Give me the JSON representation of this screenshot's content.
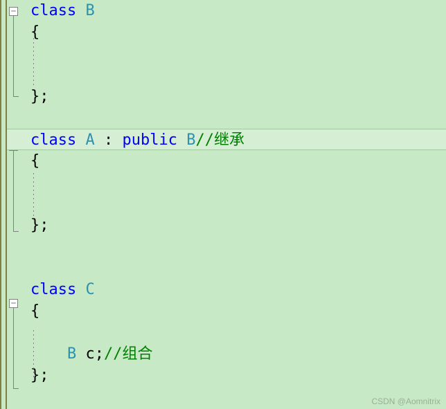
{
  "classes": {
    "b": {
      "keyword": "class",
      "name": "B",
      "open": "{",
      "close": "};"
    },
    "a": {
      "keyword": "class",
      "name": "A",
      "colon": " : ",
      "access": "public",
      "base": "B",
      "comment": "//继承",
      "open": "{",
      "close": "};"
    },
    "c": {
      "keyword": "class",
      "name": "C",
      "open": "{",
      "member_type": "B",
      "member_name": " c;",
      "comment": "//组合",
      "close": "};"
    }
  },
  "watermark": "CSDN @Aomnitrix"
}
